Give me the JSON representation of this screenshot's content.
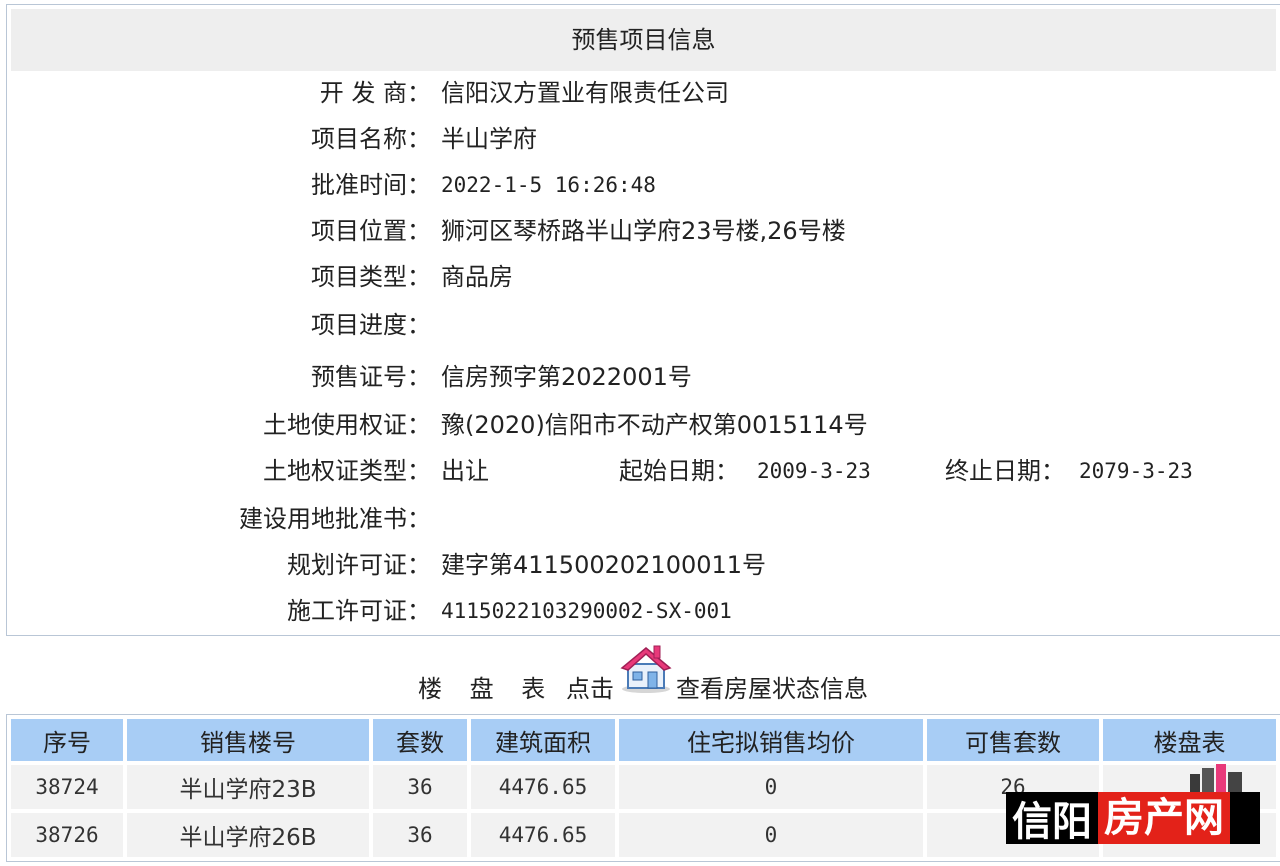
{
  "panel": {
    "title": "预售项目信息",
    "rows": [
      {
        "label": "开 发 商：",
        "value": "信阳汉方置业有限责任公司"
      },
      {
        "label": "项目名称：",
        "value": "半山学府"
      },
      {
        "label": "批准时间：",
        "value": "2022-1-5 16:26:48"
      },
      {
        "label": "项目位置：",
        "value": "狮河区琴桥路半山学府23号楼,26号楼"
      },
      {
        "label": "项目类型：",
        "value": "商品房"
      },
      {
        "label": "项目进度：",
        "value": ""
      },
      {
        "label": "预售证号：",
        "value": "信房预字第2022001号"
      },
      {
        "label": "土地使用权证：",
        "value": "豫(2020)信阳市不动产权第0015114号"
      },
      {
        "label": "土地权证类型：",
        "value": "出让"
      },
      {
        "label": "建设用地批准书：",
        "value": ""
      },
      {
        "label": "规划许可证：",
        "value": "建字第411500202100011号"
      },
      {
        "label": "施工许可证：",
        "value": "4115022103290002-SX-001"
      }
    ],
    "land_dates": {
      "start_label": "起始日期：",
      "start_value": "2009-3-23",
      "end_label": "终止日期：",
      "end_value": "2079-3-23"
    }
  },
  "table_caption": {
    "title": "楼 盘 表",
    "click": "点击",
    "info": "查看房屋状态信息",
    "icon": "house-icon"
  },
  "buildings": {
    "headers": [
      "序号",
      "销售楼号",
      "套数",
      "建筑面积",
      "住宅拟销售均价",
      "可售套数",
      "楼盘表"
    ],
    "rows": [
      [
        "38724",
        "半山学府23B",
        "36",
        "4476.65",
        "0",
        "26",
        ""
      ],
      [
        "38726",
        "半山学府26B",
        "36",
        "4476.65",
        "0",
        "",
        ""
      ]
    ]
  },
  "watermark": {
    "part1": "信阳",
    "part2": "房产网"
  },
  "colors": {
    "header_bg": "#a8cdf5",
    "title_bg": "#eeeeee",
    "cell_bg": "#f2f2f2",
    "watermark_red": "#e32219"
  }
}
